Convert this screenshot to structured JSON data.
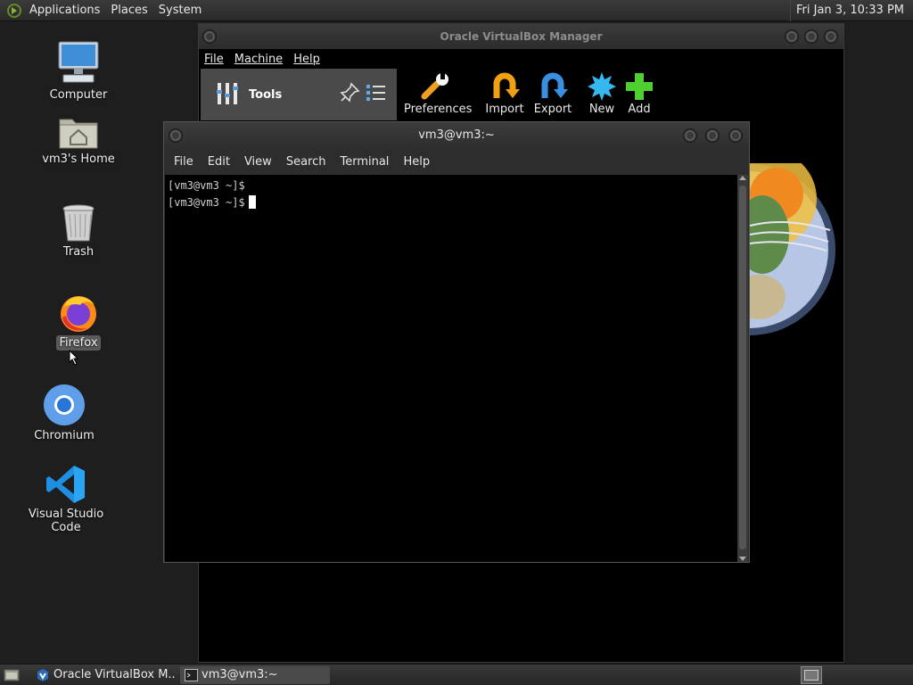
{
  "top_panel": {
    "menus": [
      "Applications",
      "Places",
      "System"
    ],
    "clock": "Fri Jan  3, 10:33 PM"
  },
  "desktop": {
    "icons": [
      {
        "label": "Computer"
      },
      {
        "label": "vm3's Home"
      },
      {
        "label": "Trash"
      },
      {
        "label": "Firefox"
      },
      {
        "label": "Chromium"
      },
      {
        "label": "Visual Studio Code"
      }
    ]
  },
  "vbox": {
    "title": "Oracle VirtualBox Manager",
    "menu": [
      "File",
      "Machine",
      "Help"
    ],
    "tools_label": "Tools",
    "toolbar": [
      "Preferences",
      "Import",
      "Export",
      "New",
      "Add"
    ]
  },
  "terminal": {
    "title": "vm3@vm3:~",
    "menu": [
      "File",
      "Edit",
      "View",
      "Search",
      "Terminal",
      "Help"
    ],
    "lines": [
      "[vm3@vm3 ~]$",
      "[vm3@vm3 ~]$"
    ]
  },
  "taskbar": {
    "tasks": [
      "Oracle VirtualBox M...",
      "vm3@vm3:~"
    ]
  },
  "colors": {
    "panel": "#2a2a2a",
    "desktop": "#1e1e1e",
    "terminal_bg": "#000000",
    "accent_green": "#4fcf2f"
  }
}
